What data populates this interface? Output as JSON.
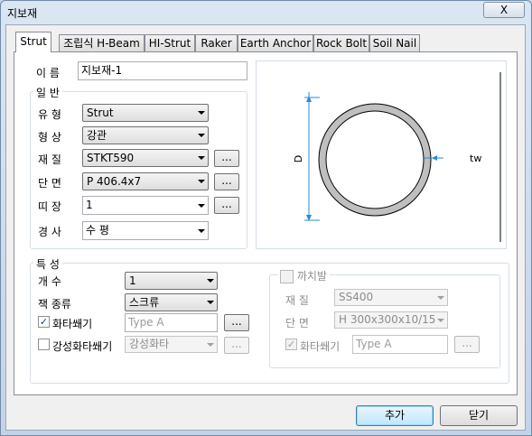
{
  "window": {
    "title": "지보재",
    "close_label": "X"
  },
  "tabs": [
    "Strut",
    "조립식 H-Beam",
    "HI-Strut",
    "Raker",
    "Earth Anchor",
    "Rock Bolt",
    "Soil Nail"
  ],
  "name_row": {
    "label": "이 름",
    "value": "지보재-1"
  },
  "general": {
    "title": "일 반",
    "type_label": "유 형",
    "type_value": "Strut",
    "shape_label": "형 상",
    "shape_value": "강관",
    "material_label": "재 질",
    "material_value": "STKT590",
    "section_label": "단 면",
    "section_value": "P 406.4x7",
    "wale_label": "띠 장",
    "wale_value": "1",
    "slope_label": "경 사",
    "slope_value": "수 평",
    "browse": "..."
  },
  "diagram": {
    "d_label": "D",
    "tw_label": "tw"
  },
  "props": {
    "title": "특 성",
    "count_label": "개 수",
    "count_value": "1",
    "jack_label": "잭 종류",
    "jack_value": "스크류",
    "wedge_label": "화타쐐기",
    "wedge_checked": true,
    "wedge_placeholder": "Type A",
    "strong_wedge_label": "강성화타쐐기",
    "strong_wedge_checked": false,
    "strong_wedge_value": "강성화타",
    "browse": "..."
  },
  "bracing": {
    "title": "까치발",
    "material_label": "재 질",
    "material_value": "SS400",
    "section_label": "단 면",
    "section_value": "H 300x300x10/15",
    "wedge_label": "화타쐐기",
    "wedge_value": "Type A",
    "browse": "..."
  },
  "buttons": {
    "add": "추가",
    "close": "닫기"
  }
}
